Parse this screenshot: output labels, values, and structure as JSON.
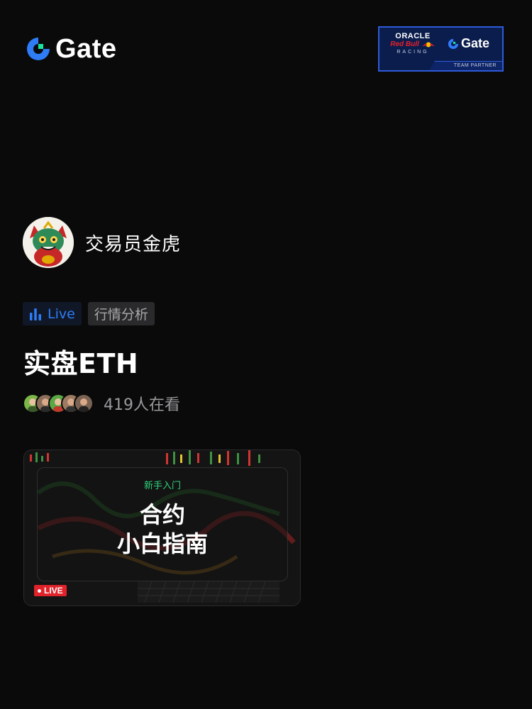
{
  "header": {
    "brand_name": "Gate",
    "partner": {
      "oracle": "ORACLE",
      "redbull": "Red Bull",
      "racing": "RACING",
      "gate": "Gate",
      "tagline": "TEAM PARTNER"
    }
  },
  "streamer": {
    "name": "交易员金虎",
    "avatar_icon": "tiger-mascot-avatar"
  },
  "tags": {
    "live_label": "Live",
    "category": "行情分析"
  },
  "stream": {
    "title": "实盘ETH",
    "viewer_count_text": "419人在看",
    "thumbnail": {
      "subtitle": "新手入门",
      "line1": "合约",
      "line2": "小白指南",
      "badge": "LIVE"
    }
  },
  "colors": {
    "background": "#0a0a0a",
    "brand_blue": "#2e7cf6",
    "brand_green": "#17e6a1",
    "live_red": "#e0222a",
    "partner_navy": "#0b1d4d"
  }
}
